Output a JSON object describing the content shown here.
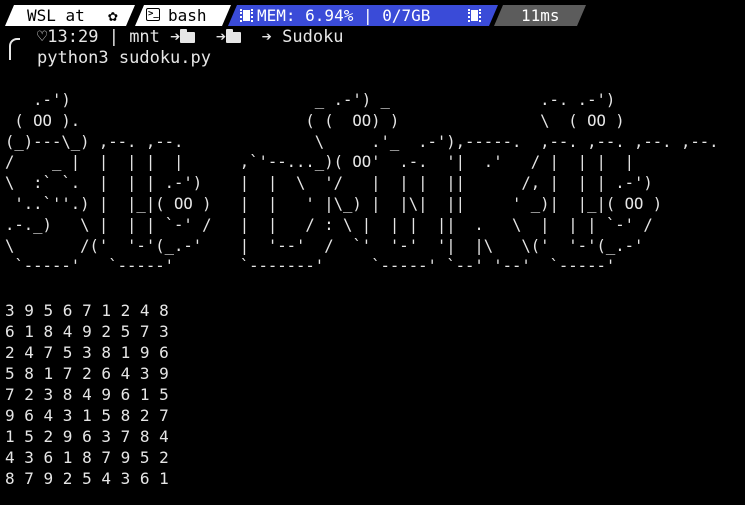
{
  "prompt": {
    "segments": {
      "host": "WSL at",
      "host_icon": "settings-gear-icon",
      "shell": "bash",
      "shell_icon": "terminal-icon",
      "mem": "MEM: 6.94% | 0/7GB",
      "mem_icon": "memory-chip-icon",
      "duration": "11ms"
    },
    "colors": {
      "host_bg": "#ffffff",
      "mem_bg": "#3a4bd8",
      "time_bg": "#5c5c5c",
      "terminal_bg": "#000000",
      "text": "#e6e6e6"
    },
    "line2": {
      "time": "13:29",
      "sep": "|",
      "dir1": "mnt",
      "dir_final": "Sudoku"
    },
    "command": "python3 sudoku.py"
  },
  "banner": "   .-')                          _ .-') _                .-. .-')\n ( OO ).                        ( (  OO) )               \\  ( OO )\n(_)---\\_) ,--. ,--.              \\     .'_  .-'),-----.  ,--. ,--. ,--. ,--.\n/    _ |  |  | |  |      ,`'--..._)( OO'  .-.  '|  .'   / |  | |  |\n\\  :` `.  |  | | .-')    |  |  \\  '/   |  | |  ||      /, |  | | .-')\n '..`''.) |  |_|( OO )   |  |   ' |\\_) |  |\\|  ||     ' _)|  |_|( OO )\n.-._)   \\ |  | | `-' /   |  |   / : \\ |  | |  ||  .   \\  |  | | `-' /\n\\       /('  '-'(_.-'    |  '--'  /  `'  '-'  '|  |\\   \\('  '-'(_.-'\n `-----'   `-----'       `-------'     `-----' `--' '--'  `-----'",
  "sudoku": [
    "3 9 5 6 7 1 2 4 8",
    "6 1 8 4 9 2 5 7 3",
    "2 4 7 5 3 8 1 9 6",
    "5 8 1 7 2 6 4 3 9",
    "7 2 3 8 4 9 6 1 5",
    "9 6 4 3 1 5 8 2 7",
    "1 5 2 9 6 3 7 8 4",
    "4 3 6 1 8 7 9 5 2",
    "8 7 9 2 5 4 3 6 1"
  ]
}
